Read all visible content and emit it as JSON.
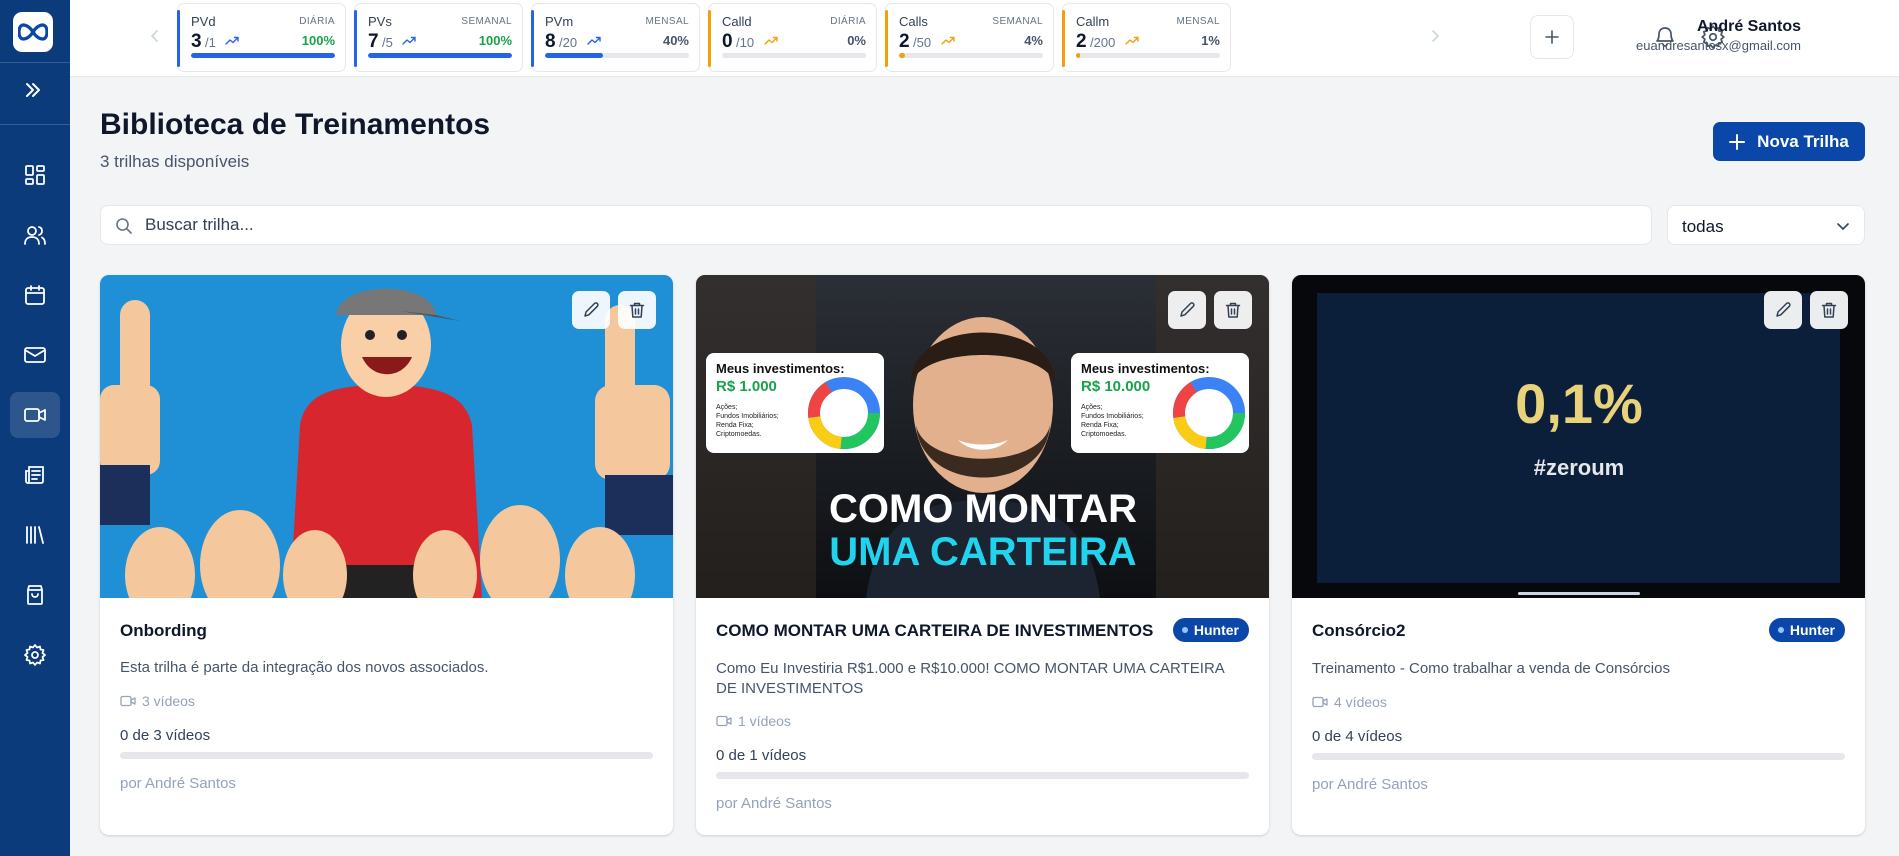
{
  "sidebar": {
    "items": [
      {
        "name": "dashboard-icon",
        "active": false
      },
      {
        "name": "users-icon",
        "active": false
      },
      {
        "name": "calendar-icon",
        "active": false
      },
      {
        "name": "mail-icon",
        "active": false
      },
      {
        "name": "video-icon",
        "active": true
      },
      {
        "name": "newspaper-icon",
        "active": false
      },
      {
        "name": "library-icon",
        "active": false
      },
      {
        "name": "shopping-bag-icon",
        "active": false
      },
      {
        "name": "settings-icon",
        "active": false
      }
    ]
  },
  "kpis": [
    {
      "name": "PVd",
      "period": "DIÁRIA",
      "value": "3",
      "target": "/1",
      "percent": "100%",
      "progress": 1.0,
      "color": "#2563eb",
      "pct_color": "#16a34a"
    },
    {
      "name": "PVs",
      "period": "SEMANAL",
      "value": "7",
      "target": "/5",
      "percent": "100%",
      "progress": 1.0,
      "color": "#2563eb",
      "pct_color": "#16a34a"
    },
    {
      "name": "PVm",
      "period": "MENSAL",
      "value": "8",
      "target": "/20",
      "percent": "40%",
      "progress": 0.4,
      "color": "#2563eb",
      "pct_color": "#475569"
    },
    {
      "name": "Calld",
      "period": "DIÁRIA",
      "value": "0",
      "target": "/10",
      "percent": "0%",
      "progress": 0.0,
      "color": "#f59e0b",
      "pct_color": "#475569"
    },
    {
      "name": "Calls",
      "period": "SEMANAL",
      "value": "2",
      "target": "/50",
      "percent": "4%",
      "progress": 0.04,
      "color": "#f59e0b",
      "pct_color": "#475569"
    },
    {
      "name": "Callm",
      "period": "MENSAL",
      "value": "2",
      "target": "/200",
      "percent": "1%",
      "progress": 0.01,
      "color": "#f59e0b",
      "pct_color": "#475569"
    }
  ],
  "user": {
    "name": "André Santos",
    "email": "euandresantosx@gmail.com"
  },
  "page": {
    "title": "Biblioteca de Treinamentos",
    "subtitle": "3 trilhas disponíveis",
    "new_button": "Nova Trilha"
  },
  "search": {
    "placeholder": "Buscar trilha..."
  },
  "filter": {
    "selected": "todas"
  },
  "cards": [
    {
      "title": "Onbording",
      "badge": "",
      "description": "Esta trilha é parte da integração dos novos associados.",
      "videos": "3 vídeos",
      "progress_label": "0 de 3 vídeos",
      "progress": 0,
      "author": "por André Santos"
    },
    {
      "title": "COMO MONTAR UMA CARTEIRA DE INVESTIMENTOS",
      "badge": "Hunter",
      "description": "Como Eu Investiria R$1.000 e R$10.000! COMO MONTAR UMA CARTEIRA DE INVESTIMENTOS",
      "videos": "1 vídeos",
      "progress_label": "0 de 1 vídeos",
      "progress": 0,
      "author": "por André Santos",
      "thumb": {
        "panel_left_title": "Meus investimentos:",
        "panel_left_value": "R$ 1.000",
        "panel_right_title": "Meus investimentos:",
        "panel_right_value": "R$ 10.000",
        "panel_items": [
          "Ações;",
          "Fundos Imobiliários;",
          "Renda Fixa;",
          "Criptomoedas."
        ],
        "line1": "COMO MONTAR",
        "line2": "UMA CARTEIRA"
      }
    },
    {
      "title": "Consórcio2",
      "badge": "Hunter",
      "description": "Treinamento - Como trabalhar a venda de Consórcios",
      "videos": "4 vídeos",
      "progress_label": "0 de 4 vídeos",
      "progress": 0,
      "author": "por André Santos",
      "thumb": {
        "big": "0,1%",
        "tag": "#zeroum"
      }
    }
  ],
  "colors": {
    "sidebar": "#0b3b7a",
    "primary": "#0b47a8"
  }
}
